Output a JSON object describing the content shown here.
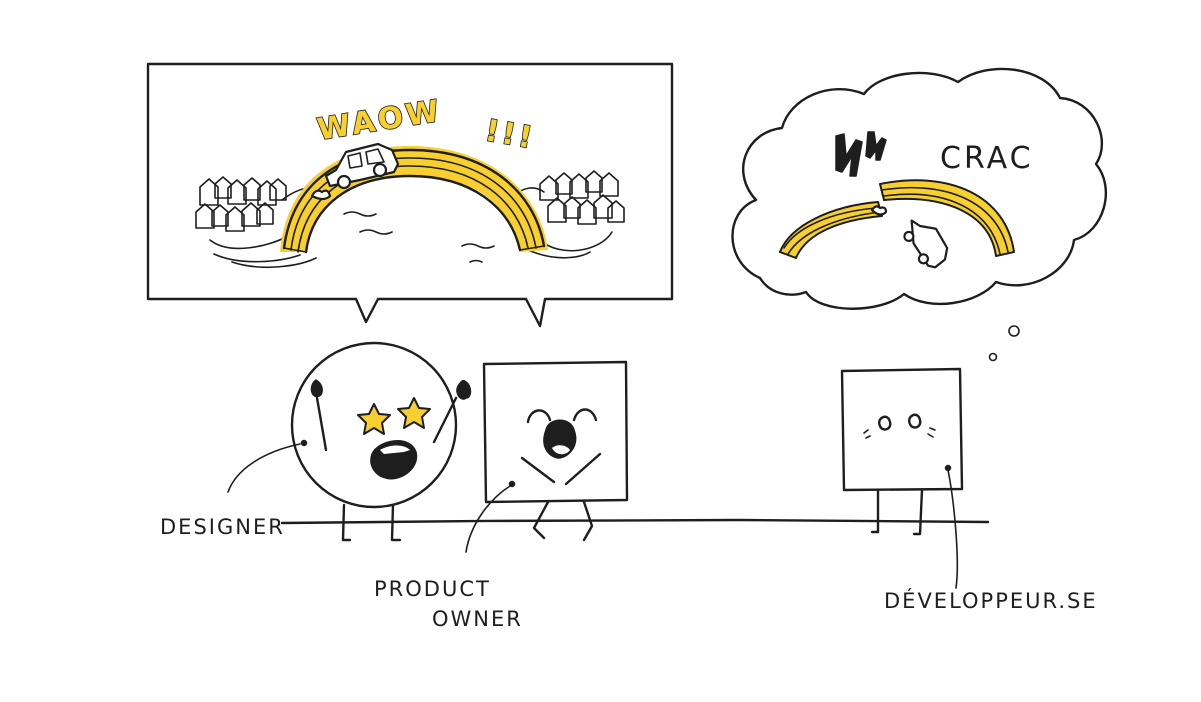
{
  "speech_bubble": {
    "exclamation": "WAOW",
    "bang": "!!!"
  },
  "thought_bubble": {
    "exclamation": "CRAC"
  },
  "characters": {
    "designer": {
      "label": "DESIGNER"
    },
    "product_owner": {
      "label_line1": "PRODUCT",
      "label_line2": "OWNER"
    },
    "developer": {
      "label": "DÉVELOPPEUR.SE"
    }
  },
  "colors": {
    "accent_yellow": "#f7cf2f",
    "ink": "#1e1e1e",
    "background": "#ffffff"
  }
}
